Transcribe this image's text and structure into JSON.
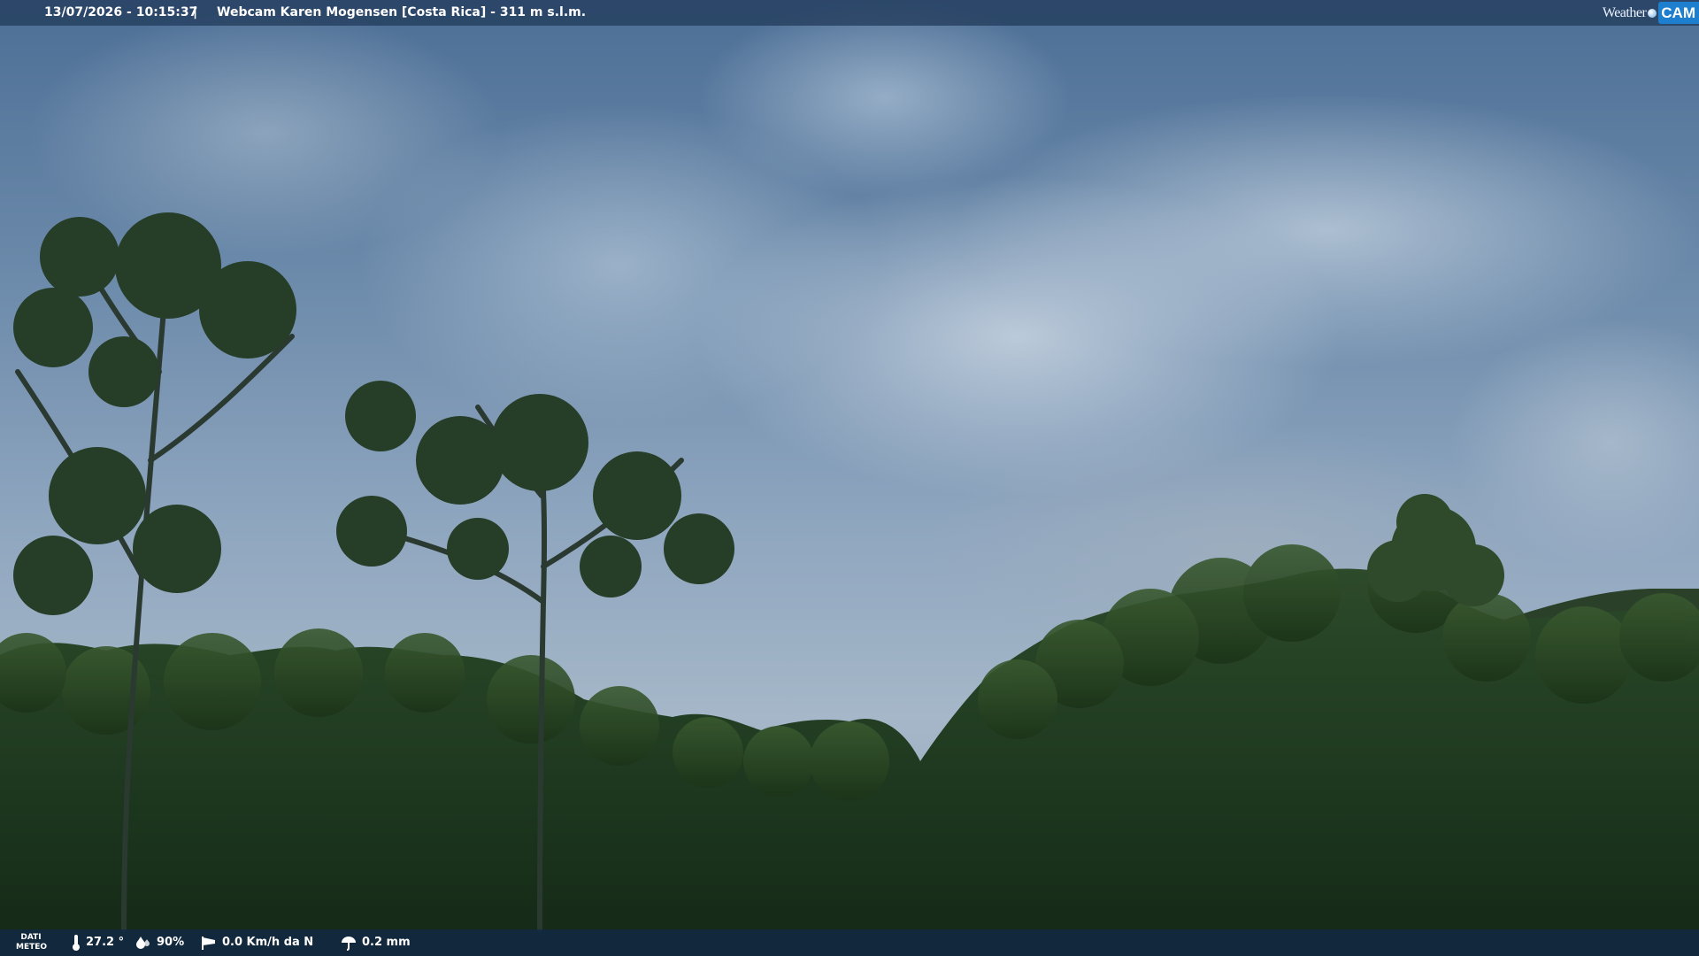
{
  "header": {
    "datetime": "13/07/2026 - 10:15:37",
    "separator": "|",
    "title": "Webcam Karen Mogensen [Costa Rica] - 311 m s.l.m."
  },
  "logo": {
    "weather": "Weather",
    "cam": "CAM"
  },
  "weather_bar": {
    "label_line1": "DATI",
    "label_line2": "METEO",
    "temperature": "27.2 °",
    "humidity": "90%",
    "wind": "0.0 Km/h da N",
    "rain": "0.2 mm"
  },
  "icons": {
    "temperature": "thermometer-icon",
    "humidity": "humidity-drop-icon",
    "wind": "wind-sock-icon",
    "rain": "rain-umbrella-icon"
  },
  "colors": {
    "top_bar": "#223c5c",
    "bottom_bar": "#122844",
    "logo_accent": "#1f7fcf"
  }
}
